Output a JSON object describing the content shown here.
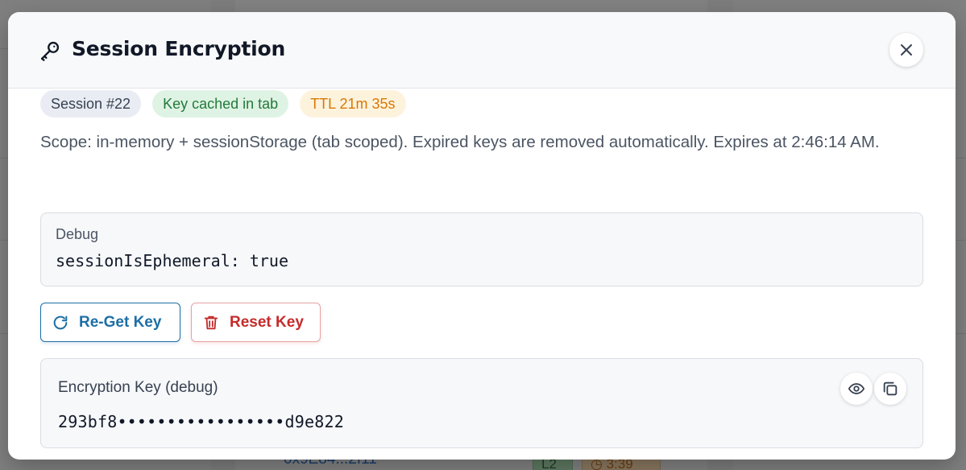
{
  "modal": {
    "title": "Session Encryption",
    "title_icon": "key-icon",
    "close_icon": "close-icon"
  },
  "badges": {
    "session": "Session #22",
    "cached": "Key cached in tab",
    "ttl": "TTL 21m 35s"
  },
  "scope_text": "Scope: in-memory + sessionStorage (tab scoped). Expired keys are removed automatically. Expires at 2:46:14 AM.",
  "debug": {
    "label": "Debug",
    "code": "sessionIsEphemeral: true"
  },
  "actions": {
    "reget_label": "Re-Get Key",
    "reget_icon": "refresh-icon",
    "reset_label": "Reset Key",
    "reset_icon": "trash-icon"
  },
  "encryption_key": {
    "label": "Encryption Key (debug)",
    "value": "293bf8•••••••••••••••••d9e822",
    "show_icon": "eye-icon",
    "copy_icon": "copy-icon"
  },
  "colors": {
    "primary": "#1d6fa5",
    "danger": "#c52b2b",
    "success_bg": "#dff3e4",
    "warning_text": "#d97706"
  },
  "background": {
    "link_text": "0x9E84...2f11",
    "chip_level": "L2",
    "chip_time": "3:39"
  }
}
